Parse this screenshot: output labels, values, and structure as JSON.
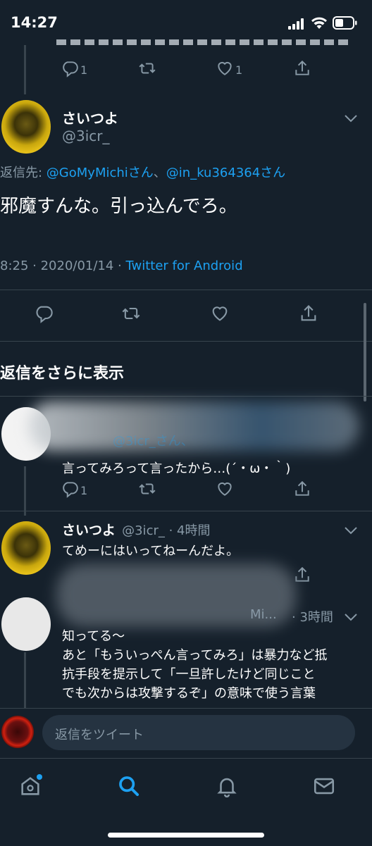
{
  "status_bar": {
    "time": "14:27"
  },
  "prev_tweet": {
    "reply_count": "1",
    "like_count": "1"
  },
  "main_tweet": {
    "display_name": "さいつよ",
    "handle": "@3icr_",
    "reply_to_prefix": "返信先: ",
    "reply_to_user1": "@GoMyMichiさん",
    "reply_to_sep": "、",
    "reply_to_user2": "@in_ku364364さん",
    "text": "邪魔すんな。引っ込んでろ。",
    "timestamp": "8:25 · 2020/01/14 · ",
    "client": "Twitter for Android"
  },
  "more_replies_heading": "返信をさらに表示",
  "replies": [
    {
      "reply_to_fragment": "@3icr_さん、",
      "text": "言ってみろって言ったから…(´・ω・｀)",
      "reply_count": "1"
    },
    {
      "display_name": "さいつよ",
      "meta": "@3icr_ · 4時間",
      "text": "てめーにはいってねーんだよ。"
    },
    {
      "handle_fragment": "Mi...",
      "meta": "· 3時間",
      "line1": "知ってる〜",
      "line2": "あと「もういっぺん言ってみろ」は暴力など抵",
      "line3": "抗手段を提示して「一旦許したけど同じこと",
      "line4": "でも次からは攻撃するぞ」の意味で使う言葉"
    }
  ],
  "compose": {
    "placeholder": "返信をツイート"
  },
  "colors": {
    "background": "#15202b",
    "accent": "#1da1f2",
    "muted": "#8899a6",
    "divider": "#38444d"
  }
}
